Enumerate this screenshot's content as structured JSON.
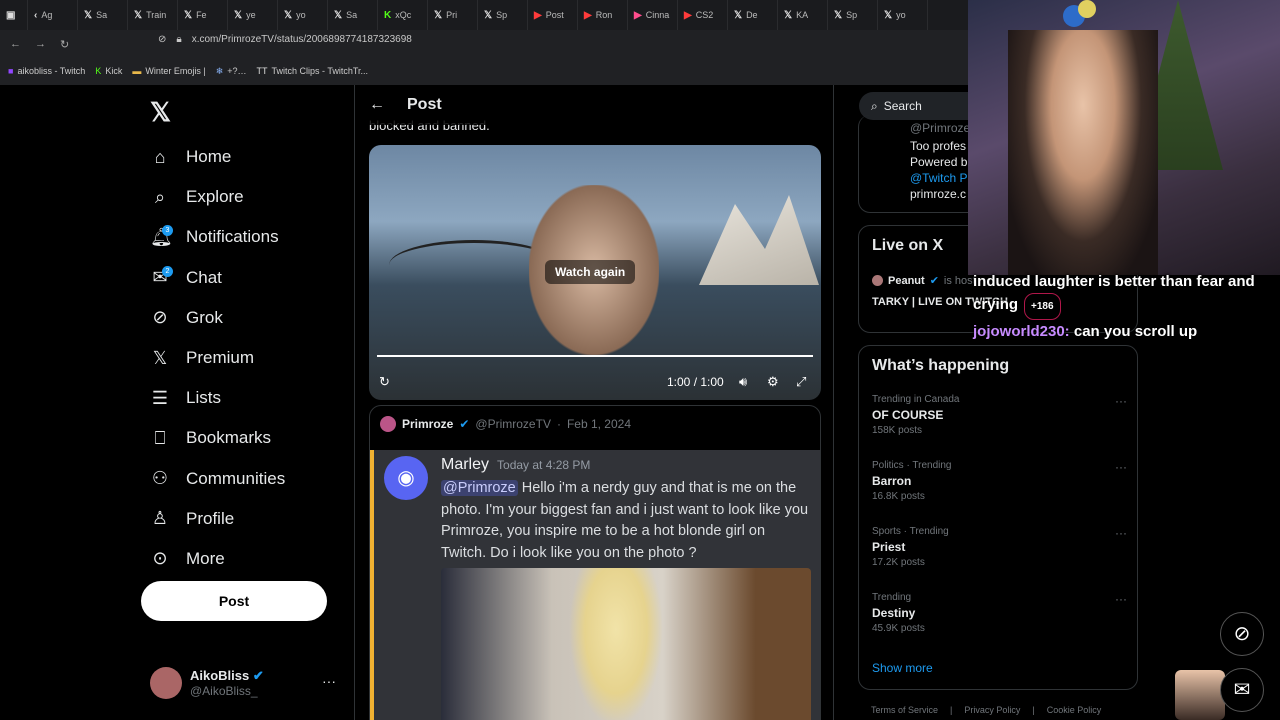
{
  "browser": {
    "tabs": [
      "Ag",
      "Sa",
      "Train",
      "Fe",
      "ye",
      "yo",
      "Sa",
      "xQc",
      "Pri",
      "Sp",
      "Post",
      "Ron",
      "Cinna",
      "CS2",
      "De",
      "KA",
      "Sp",
      "yo"
    ],
    "url": "x.com/PrimrozeTV/status/2006898774187323698",
    "bookmarks": [
      "aikobliss - Twitch",
      "Kick",
      "Winter Emojis |",
      "+?…",
      "Twitch Clips - TwitchTr..."
    ]
  },
  "nav": {
    "items": [
      {
        "label": "Home",
        "icon": "home-icon"
      },
      {
        "label": "Explore",
        "icon": "search-icon"
      },
      {
        "label": "Notifications",
        "icon": "bell-icon",
        "badge": "3"
      },
      {
        "label": "Chat",
        "icon": "mail-icon",
        "badge": "2"
      },
      {
        "label": "Grok",
        "icon": "grok-icon"
      },
      {
        "label": "Premium",
        "icon": "x-icon"
      },
      {
        "label": "Lists",
        "icon": "list-icon"
      },
      {
        "label": "Bookmarks",
        "icon": "bookmark-icon"
      },
      {
        "label": "Communities",
        "icon": "people-icon"
      },
      {
        "label": "Profile",
        "icon": "person-icon"
      },
      {
        "label": "More",
        "icon": "more-icon"
      }
    ],
    "post_button": "Post",
    "account": {
      "name": "AikoBliss",
      "handle": "@AikoBliss_"
    }
  },
  "main": {
    "header_title": "Post",
    "cut_text": "blocked and banned.",
    "video": {
      "watch_again": "Watch again",
      "time": "1:00 / 1:00",
      "progress": 1.0
    },
    "quote": {
      "name": "Primroze",
      "handle": "@PrimrozeTV",
      "date": "Feb 1, 2024"
    },
    "discord": {
      "author": "Marley",
      "timestamp": "Today at 4:28 PM",
      "mention": "@Primroze",
      "message": "Hello i'm a nerdy guy and that is me on the photo. I'm your biggest fan and i just want to look like you Primroze, you inspire me to be a hot blonde girl on Twitch. Do i look like you on the photo ?"
    }
  },
  "right": {
    "search_placeholder": "Search",
    "card_lines": [
      "@Primroze",
      "Too profes",
      "Powered b",
      "@Twitch P",
      "primroze.c"
    ],
    "live": {
      "title": "Live on X",
      "streamer": "Peanut",
      "status": "is host",
      "stream_title": "TARKY | LIVE ON TWITCH"
    },
    "whats": {
      "title": "What’s happening",
      "trends": [
        {
          "context": "Trending in Canada",
          "name": "OF COURSE",
          "posts": "158K posts"
        },
        {
          "context": "Politics · Trending",
          "name": "Barron",
          "posts": "16.8K posts"
        },
        {
          "context": "Sports · Trending",
          "name": "Priest",
          "posts": "17.2K posts"
        },
        {
          "context": "Trending",
          "name": "Destiny",
          "posts": "45.9K posts"
        }
      ],
      "show_more": "Show more"
    },
    "footer": [
      "Terms of Service",
      "Privacy Policy",
      "Cookie Policy"
    ]
  },
  "overlay": {
    "chat_line1": "induced laughter is better than fear and crying",
    "viewer_count": "+186",
    "chat_user": "jojoworld230:",
    "chat_msg": "can you scroll up"
  }
}
